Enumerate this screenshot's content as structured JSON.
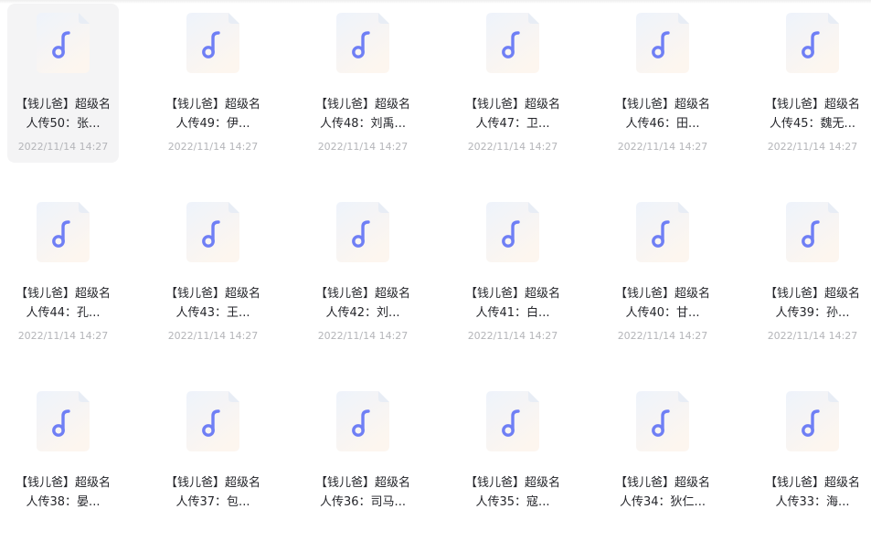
{
  "colors": {
    "icon_note": "#6f7ff5",
    "icon_bg_top": "#eef3fb",
    "icon_bg_bottom": "#fdf6ef",
    "selected_bg": "#f4f4f5",
    "date_text": "#b4b5b9"
  },
  "icon_name": "music-note-icon",
  "files": [
    {
      "line1": "【钱儿爸】超级名",
      "line2": "人传50：张...",
      "date": "2022/11/14 14:27",
      "selected": true
    },
    {
      "line1": "【钱儿爸】超级名",
      "line2": "人传49：伊...",
      "date": "2022/11/14 14:27"
    },
    {
      "line1": "【钱儿爸】超级名",
      "line2": "人传48：刘禹...",
      "date": "2022/11/14 14:27"
    },
    {
      "line1": "【钱儿爸】超级名",
      "line2": "人传47：卫...",
      "date": "2022/11/14 14:27"
    },
    {
      "line1": "【钱儿爸】超级名",
      "line2": "人传46：田...",
      "date": "2022/11/14 14:27"
    },
    {
      "line1": "【钱儿爸】超级名",
      "line2": "人传45：魏无...",
      "date": "2022/11/14 14:27"
    },
    {
      "line1": "【钱儿爸】超级名",
      "line2": "人传44：孔...",
      "date": "2022/11/14 14:27"
    },
    {
      "line1": "【钱儿爸】超级名",
      "line2": "人传43：王...",
      "date": "2022/11/14 14:27"
    },
    {
      "line1": "【钱儿爸】超级名",
      "line2": "人传42：刘...",
      "date": "2022/11/14 14:27"
    },
    {
      "line1": "【钱儿爸】超级名",
      "line2": "人传41：白...",
      "date": "2022/11/14 14:27"
    },
    {
      "line1": "【钱儿爸】超级名",
      "line2": "人传40：甘...",
      "date": "2022/11/14 14:27"
    },
    {
      "line1": "【钱儿爸】超级名",
      "line2": "人传39：孙...",
      "date": "2022/11/14 14:27"
    },
    {
      "line1": "【钱儿爸】超级名",
      "line2": "人传38：晏...",
      "date": ""
    },
    {
      "line1": "【钱儿爸】超级名",
      "line2": "人传37：包...",
      "date": ""
    },
    {
      "line1": "【钱儿爸】超级名",
      "line2": "人传36：司马...",
      "date": ""
    },
    {
      "line1": "【钱儿爸】超级名",
      "line2": "人传35：寇...",
      "date": ""
    },
    {
      "line1": "【钱儿爸】超级名",
      "line2": "人传34：狄仁...",
      "date": ""
    },
    {
      "line1": "【钱儿爸】超级名",
      "line2": "人传33：海...",
      "date": ""
    }
  ]
}
